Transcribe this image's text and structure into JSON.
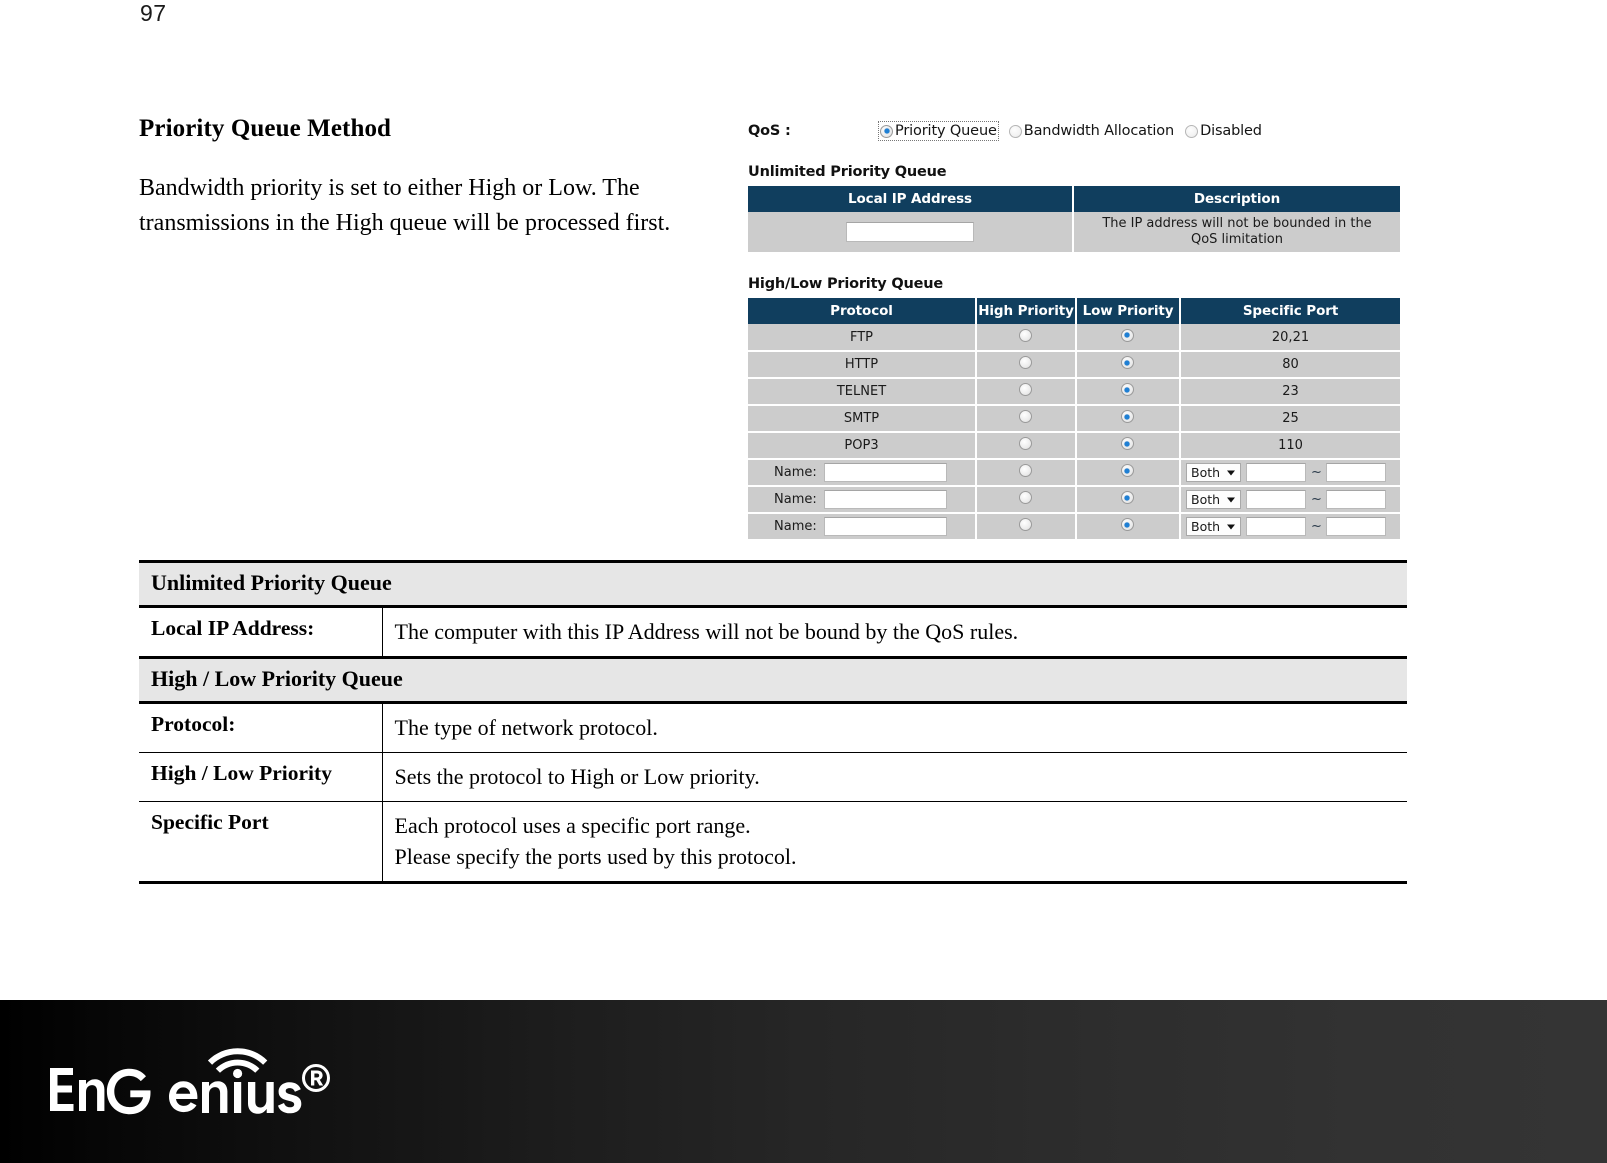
{
  "page": {
    "number": "97"
  },
  "doc": {
    "heading": "Priority Queue Method",
    "paragraph": "Bandwidth priority is set to either High or Low. The transmissions in the High queue will be processed first."
  },
  "screenshot": {
    "qos": {
      "label": "QoS :",
      "options": [
        {
          "label": "Priority Queue",
          "selected": true
        },
        {
          "label": "Bandwidth Allocation",
          "selected": false
        },
        {
          "label": "Disabled",
          "selected": false
        }
      ]
    },
    "unlimited_queue": {
      "title": "Unlimited Priority Queue",
      "headers": [
        "Local IP Address",
        "Description"
      ],
      "row": {
        "ip_value": "",
        "ip_placeholder": "",
        "description": "The IP address will not be bounded in the QoS limitation"
      }
    },
    "high_low_queue": {
      "title": "High/Low Priority Queue",
      "headers": [
        "Protocol",
        "High Priority",
        "Low Priority",
        "Specific Port"
      ],
      "protocol_rows": [
        {
          "protocol": "FTP",
          "high": false,
          "low": true,
          "port": "20,21"
        },
        {
          "protocol": "HTTP",
          "high": false,
          "low": true,
          "port": "80"
        },
        {
          "protocol": "TELNET",
          "high": false,
          "low": true,
          "port": "23"
        },
        {
          "protocol": "SMTP",
          "high": false,
          "low": true,
          "port": "25"
        },
        {
          "protocol": "POP3",
          "high": false,
          "low": true,
          "port": "110"
        }
      ],
      "custom_rows": [
        {
          "name_label": "Name:",
          "name_value": "",
          "high": false,
          "low": true,
          "proto_select": "Both",
          "port_from": "",
          "tilde": "~",
          "port_to": ""
        },
        {
          "name_label": "Name:",
          "name_value": "",
          "high": false,
          "low": true,
          "proto_select": "Both",
          "port_from": "",
          "tilde": "~",
          "port_to": ""
        },
        {
          "name_label": "Name:",
          "name_value": "",
          "high": false,
          "low": true,
          "proto_select": "Both",
          "port_from": "",
          "tilde": "~",
          "port_to": ""
        }
      ]
    }
  },
  "description_table": {
    "sections": [
      {
        "title": "Unlimited Priority Queue",
        "rows": [
          {
            "label": "Local IP Address:",
            "value": "The computer with this IP Address will not be bound by the QoS rules."
          }
        ]
      },
      {
        "title": "High / Low Priority Queue",
        "rows": [
          {
            "label": "Protocol:",
            "value": "The type of network protocol."
          },
          {
            "label": "High / Low Priority",
            "value": "Sets the protocol to High or Low priority."
          },
          {
            "label": "Specific Port",
            "value": "Each protocol uses a specific port range.\nPlease specify the ports used by this protocol."
          }
        ]
      }
    ]
  },
  "footer": {
    "brand": "EnGenius",
    "trademark": "®"
  },
  "colors": {
    "table_header_bg": "#103e5e",
    "table_cell_bg": "#cccccc",
    "section_head_bg": "#e6e6e6",
    "radio_selected": "#1e7fd4",
    "footer_start": "#000000",
    "footer_end": "#343434"
  }
}
